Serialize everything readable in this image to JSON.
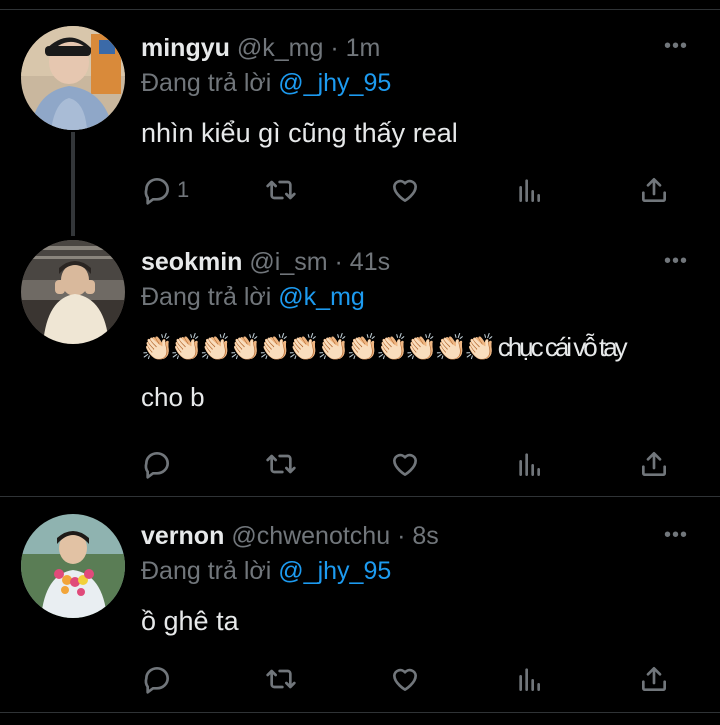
{
  "tweets": [
    {
      "name": "mingyu",
      "handle": "@k_mg",
      "dot": "·",
      "time": "1m",
      "reply_prefix": "Đang trả lời",
      "reply_mention": "@_jhy_95",
      "text_lines": [
        "nhìn kiểu gì cũng thấy real"
      ],
      "reply_count": "1",
      "more": "•••"
    },
    {
      "name": "seokmin",
      "handle": "@i_sm",
      "dot": "·",
      "time": "41s",
      "reply_prefix": "Đang trả lời",
      "reply_mention": "@k_mg",
      "text_lines": [
        "👏🏻👏🏻👏🏻👏🏻👏🏻👏🏻👏🏻👏🏻👏🏻👏🏻👏🏻👏🏻 chục cái vỗ tay",
        "cho b"
      ],
      "reply_count": "",
      "more": "•••"
    },
    {
      "name": "vernon",
      "handle": "@chwenotchu",
      "dot": "·",
      "time": "8s",
      "reply_prefix": "Đang trả lời",
      "reply_mention": "@_jhy_95",
      "text_lines": [
        "ồ ghê ta"
      ],
      "reply_count": "",
      "more": "•••"
    }
  ],
  "icons": [
    "reply-icon",
    "retweet-icon",
    "like-icon",
    "views-icon",
    "share-icon"
  ],
  "colors": {
    "background": "#000000",
    "text": "#e7e9ea",
    "muted": "#71767b",
    "accent": "#1d9bf0",
    "divider": "#2f3336"
  }
}
